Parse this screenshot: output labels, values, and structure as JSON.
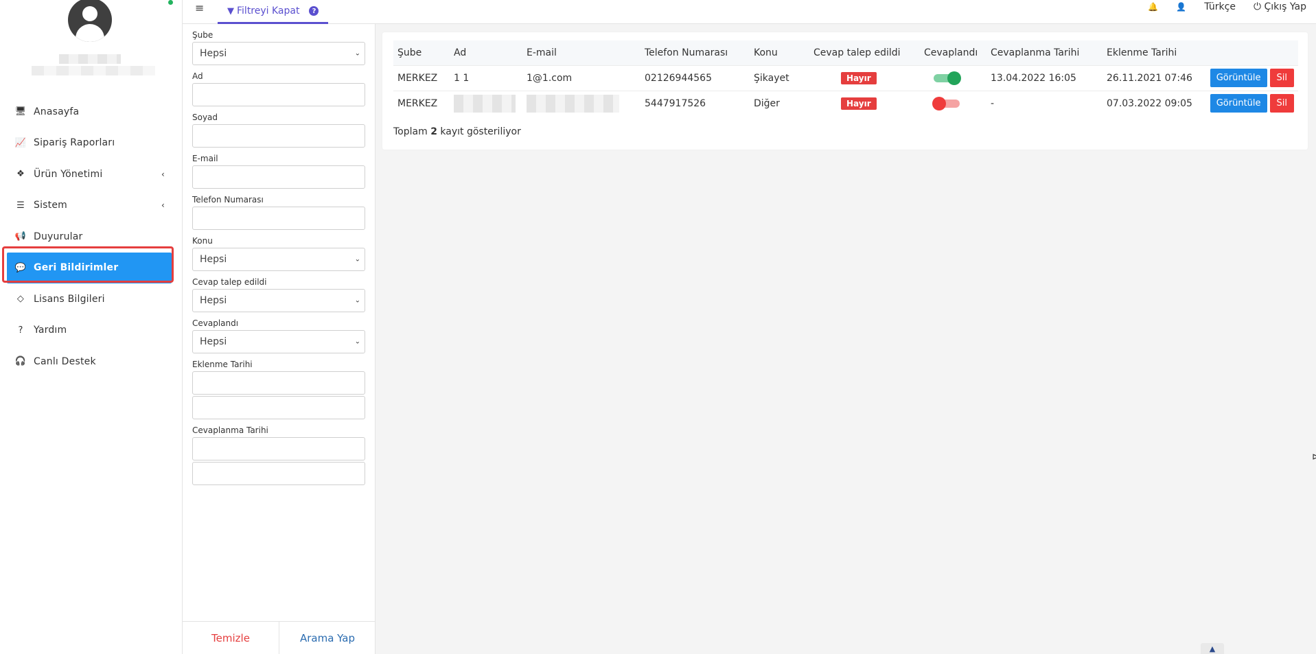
{
  "sidebar": {
    "items": [
      {
        "label": "Anasayfa",
        "icon": "monitor-icon",
        "glyph": "🖥",
        "has_sub": false
      },
      {
        "label": "Sipariş Raporları",
        "icon": "chart-icon",
        "glyph": "📈",
        "has_sub": false
      },
      {
        "label": "Ürün Yönetimi",
        "icon": "cubes-icon",
        "glyph": "❖",
        "has_sub": true
      },
      {
        "label": "Sistem",
        "icon": "server-icon",
        "glyph": "☰",
        "has_sub": true
      },
      {
        "label": "Duyurular",
        "icon": "megaphone-icon",
        "glyph": "📢",
        "has_sub": false
      },
      {
        "label": "Geri Bildirimler",
        "icon": "comment-icon",
        "glyph": "💬",
        "has_sub": false,
        "active": true
      },
      {
        "label": "Lisans Bilgileri",
        "icon": "diamond-icon",
        "glyph": "◇",
        "has_sub": false
      },
      {
        "label": "Yardım",
        "icon": "question-icon",
        "glyph": "?",
        "has_sub": false
      },
      {
        "label": "Canlı Destek",
        "icon": "headset-icon",
        "glyph": "🎧",
        "has_sub": false
      }
    ]
  },
  "topbar": {
    "menu_glyph": "≡",
    "filter_label": "Filtreyi Kapat",
    "help_glyph": "?",
    "bell_glyph": "🔔",
    "user_glyph": "👤",
    "language": "Türkçe",
    "logout_glyph": "⏻",
    "logout_label": "Çıkış Yap"
  },
  "filters": {
    "sube_label": "Şube",
    "sube_value": "Hepsi",
    "ad_label": "Ad",
    "soyad_label": "Soyad",
    "email_label": "E-mail",
    "telefon_label": "Telefon Numarası",
    "konu_label": "Konu",
    "konu_value": "Hepsi",
    "cevap_talep_label": "Cevap talep edildi",
    "cevap_talep_value": "Hepsi",
    "cevaplandi_label": "Cevaplandı",
    "cevaplandi_value": "Hepsi",
    "eklenme_label": "Eklenme Tarihi",
    "cevaplanma_label": "Cevaplanma Tarihi",
    "clear_label": "Temizle",
    "search_label": "Arama Yap"
  },
  "table": {
    "headers": [
      "Şube",
      "Ad",
      "E-mail",
      "Telefon Numarası",
      "Konu",
      "Cevap talep edildi",
      "Cevaplandı",
      "Cevaplanma Tarihi",
      "Eklenme Tarihi"
    ],
    "rows": [
      {
        "sube": "MERKEZ",
        "ad": "1 1",
        "email": "1@1.com",
        "telefon": "02126944565",
        "konu": "Şikayet",
        "cevap_talep": "Hayır",
        "cevaplandi": true,
        "cevaplanma": "13.04.2022 16:05",
        "eklenme": "26.11.2021 07:46"
      },
      {
        "sube": "MERKEZ",
        "ad": "",
        "email": "",
        "telefon": "5447917526",
        "konu": "Diğer",
        "cevap_talep": "Hayır",
        "cevaplandi": false,
        "cevaplanma": "-",
        "eklenme": "07.03.2022 09:05"
      }
    ],
    "view_label": "Görüntüle",
    "delete_label": "Sil",
    "total_prefix": "Toplam",
    "total_count": "2",
    "total_suffix": "kayıt gösteriliyor"
  },
  "colors": {
    "accent": "#5a4fcf",
    "active_nav": "#2196f3",
    "danger": "#e53e3e",
    "success": "#22a45a"
  }
}
